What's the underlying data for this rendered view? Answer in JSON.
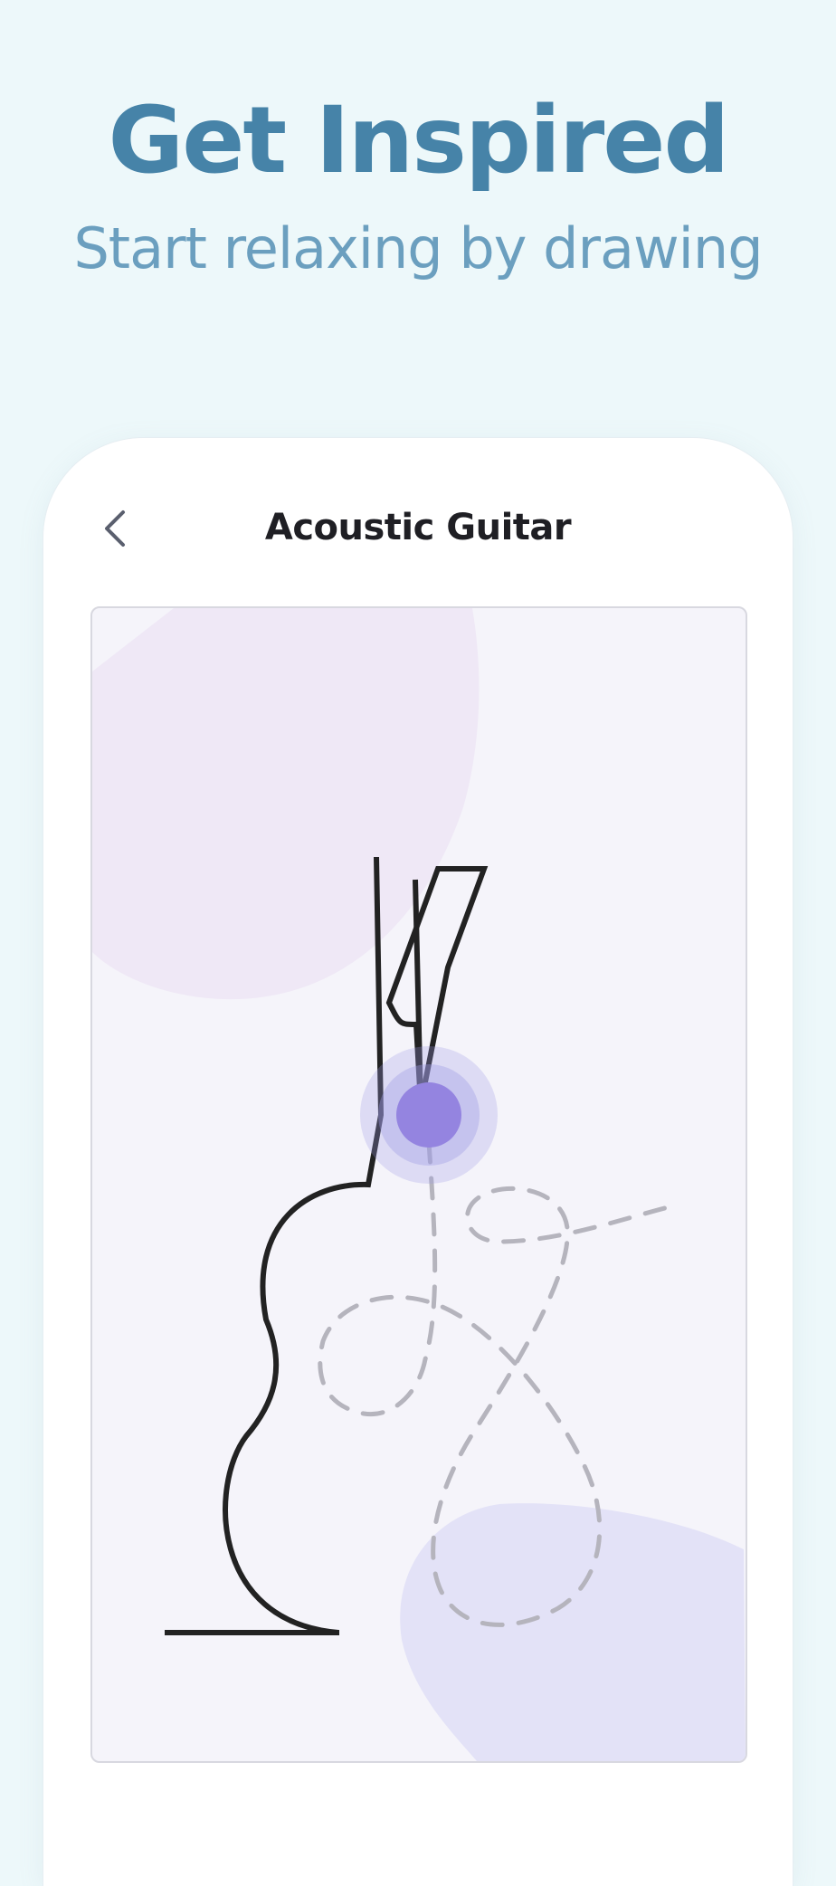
{
  "header": {
    "title": "Get Inspired",
    "subtitle": "Start relaxing by drawing"
  },
  "screen": {
    "title": "Acoustic Guitar",
    "back_icon": "chevron-left-icon"
  },
  "colors": {
    "background": "#edf8fa",
    "headline": "#4683a8",
    "subheadline": "#6b9fbf",
    "stroke": "#222222",
    "guide": "#b5b4bd",
    "cursor": "#9484e0"
  }
}
